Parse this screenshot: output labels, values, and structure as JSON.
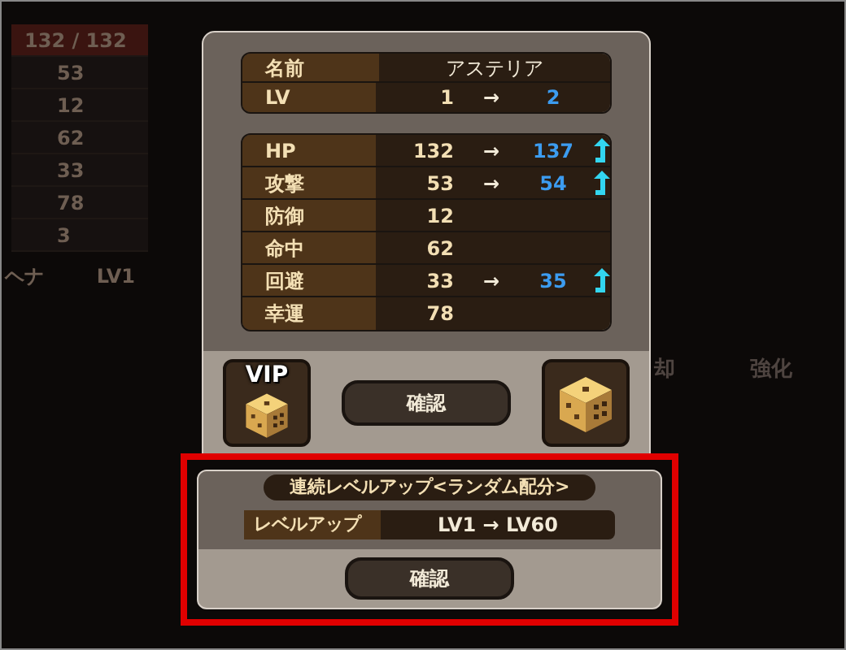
{
  "background": {
    "stats": [
      "132 / 132",
      "53",
      "12",
      "62",
      "33",
      "78",
      "3"
    ],
    "companion": {
      "name": "ヘナ",
      "level": "LV1"
    },
    "tabs": [
      "却",
      "強化"
    ]
  },
  "dialog": {
    "name_row": {
      "label": "名前",
      "value": "アステリア"
    },
    "level_row": {
      "label": "LV",
      "from": "1",
      "arrow": "→",
      "to": "2"
    },
    "stats": [
      {
        "label": "HP",
        "value": "132",
        "arrow": "→",
        "new": "137",
        "up": true
      },
      {
        "label": "攻撃",
        "value": "53",
        "arrow": "→",
        "new": "54",
        "up": true
      },
      {
        "label": "防御",
        "value": "12",
        "up": false
      },
      {
        "label": "命中",
        "value": "62",
        "up": false
      },
      {
        "label": "回避",
        "value": "33",
        "arrow": "→",
        "new": "35",
        "up": true
      },
      {
        "label": "幸運",
        "value": "78",
        "up": false
      }
    ],
    "vip_button": {
      "label": "VIP"
    },
    "confirm": "確認"
  },
  "bulk": {
    "title": "連続レベルアップ<ランダム配分>",
    "label": "レベルアップ",
    "value": "LV1 → LV60",
    "confirm": "確認",
    "highlighted": true
  }
}
